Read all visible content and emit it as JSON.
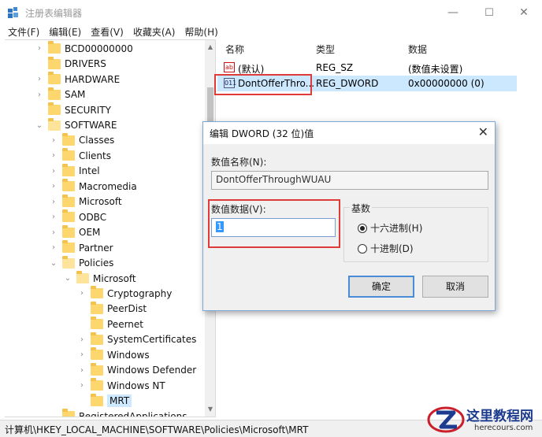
{
  "window": {
    "title": "注册表编辑器",
    "minimize": "—",
    "maximize": "☐",
    "close": "✕"
  },
  "menu": [
    "文件(F)",
    "编辑(E)",
    "查看(V)",
    "收藏夹(A)",
    "帮助(H)"
  ],
  "tree": {
    "items": [
      {
        "label": "BCD00000000",
        "chevron": "›"
      },
      {
        "label": "DRIVERS",
        "chevron": ""
      },
      {
        "label": "HARDWARE",
        "chevron": "›"
      },
      {
        "label": "SAM",
        "chevron": "›"
      },
      {
        "label": "SECURITY",
        "chevron": ""
      },
      {
        "label": "SOFTWARE",
        "chevron": "⌄"
      },
      {
        "label": "Classes",
        "chevron": "›"
      },
      {
        "label": "Clients",
        "chevron": "›"
      },
      {
        "label": "Intel",
        "chevron": "›"
      },
      {
        "label": "Macromedia",
        "chevron": "›"
      },
      {
        "label": "Microsoft",
        "chevron": "›"
      },
      {
        "label": "ODBC",
        "chevron": "›"
      },
      {
        "label": "OEM",
        "chevron": "›"
      },
      {
        "label": "Partner",
        "chevron": "›"
      },
      {
        "label": "Policies",
        "chevron": "⌄"
      },
      {
        "label": "Microsoft",
        "chevron": "⌄"
      },
      {
        "label": "Cryptography",
        "chevron": "›"
      },
      {
        "label": "PeerDist",
        "chevron": ""
      },
      {
        "label": "Peernet",
        "chevron": ""
      },
      {
        "label": "SystemCertificates",
        "chevron": "›"
      },
      {
        "label": "Windows",
        "chevron": "›"
      },
      {
        "label": "Windows Defender",
        "chevron": "›"
      },
      {
        "label": "Windows NT",
        "chevron": "›"
      },
      {
        "label": "MRT",
        "chevron": ""
      },
      {
        "label": "RegisteredApplications",
        "chevron": ""
      }
    ]
  },
  "list": {
    "columns": [
      "名称",
      "类型",
      "数据"
    ],
    "rows": [
      {
        "icon": "ab",
        "name": "(默认)",
        "type": "REG_SZ",
        "data": "(数值未设置)"
      },
      {
        "icon": "011",
        "name": "DontOfferThro...",
        "type": "REG_DWORD",
        "data": "0x00000000 (0)"
      }
    ]
  },
  "statusbar": {
    "path": "计算机\\HKEY_LOCAL_MACHINE\\SOFTWARE\\Policies\\Microsoft\\MRT"
  },
  "dialog": {
    "title": "编辑 DWORD (32 位)值",
    "close": "✕",
    "name_label": "数值名称(N):",
    "name_value": "DontOfferThroughWUAU",
    "data_label": "数值数据(V):",
    "data_value": "1",
    "base_label": "基数",
    "radio_hex": "十六进制(H)",
    "radio_dec": "十进制(D)",
    "ok": "确定",
    "cancel": "取消"
  },
  "watermark": {
    "text": "这里教程网",
    "url": "herecours.com"
  },
  "colors": {
    "highlight_box": "#e03b3b",
    "selection": "#cce8ff",
    "folder": "#fdd76e"
  }
}
